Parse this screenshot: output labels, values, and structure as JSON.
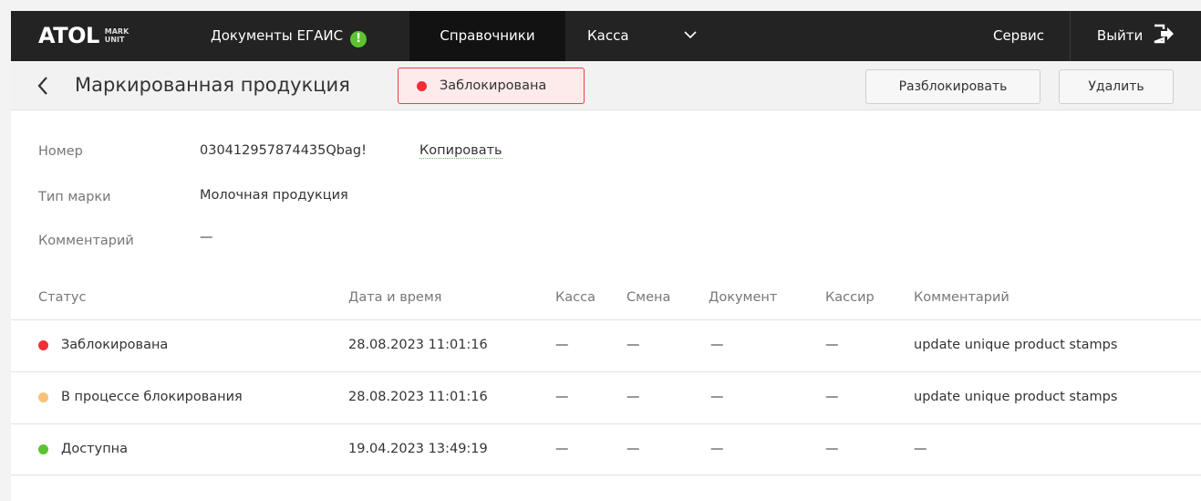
{
  "nav": {
    "logo": "ATOL",
    "logo_sub_1": "MARK",
    "logo_sub_2": "UNIT",
    "docs": "Документы ЕГАИС",
    "docs_alert": "!",
    "refs": "Справочники",
    "kassa": "Касса",
    "service": "Сервис",
    "exit": "Выйти"
  },
  "header": {
    "title": "Маркированная продукция",
    "status": "Заблокирована",
    "unlock_button": "Разблокировать",
    "delete_button": "Удалить"
  },
  "details": {
    "number_label": "Номер",
    "number_value": "030412957874435Qbag!",
    "copy_link": "Копировать",
    "type_label": "Тип марки",
    "type_value": "Молочная продукция",
    "comment_label": "Комментарий",
    "comment_value": "—"
  },
  "table": {
    "columns": [
      "Статус",
      "Дата и время",
      "Касса",
      "Смена",
      "Документ",
      "Кассир",
      "Комментарий"
    ],
    "rows": [
      {
        "status": "Заблокирована",
        "status_color": "#ee2f37",
        "datetime": "28.08.2023 11:01:16",
        "kassa": "—",
        "shift": "—",
        "document": "—",
        "cashier": "—",
        "comment": "update unique product stamps"
      },
      {
        "status": "В процессе блокирования",
        "status_color": "#f8c27a",
        "datetime": "28.08.2023 11:01:16",
        "kassa": "—",
        "shift": "—",
        "document": "—",
        "cashier": "—",
        "comment": "update unique product stamps"
      },
      {
        "status": "Доступна",
        "status_color": "#5cc431",
        "datetime": "19.04.2023 13:49:19",
        "kassa": "—",
        "shift": "—",
        "document": "—",
        "cashier": "—",
        "comment": "—"
      }
    ]
  },
  "colors": {
    "topbar": "#232323",
    "blocked": "#ee2f37",
    "in_progress": "#f8c27a",
    "available": "#5cc431",
    "badge_border": "#ee3f47"
  },
  "icons": {
    "back": "chevron-left-icon",
    "alert": "alert-icon",
    "dropdown": "chevron-down-icon",
    "exit": "logout-icon"
  }
}
